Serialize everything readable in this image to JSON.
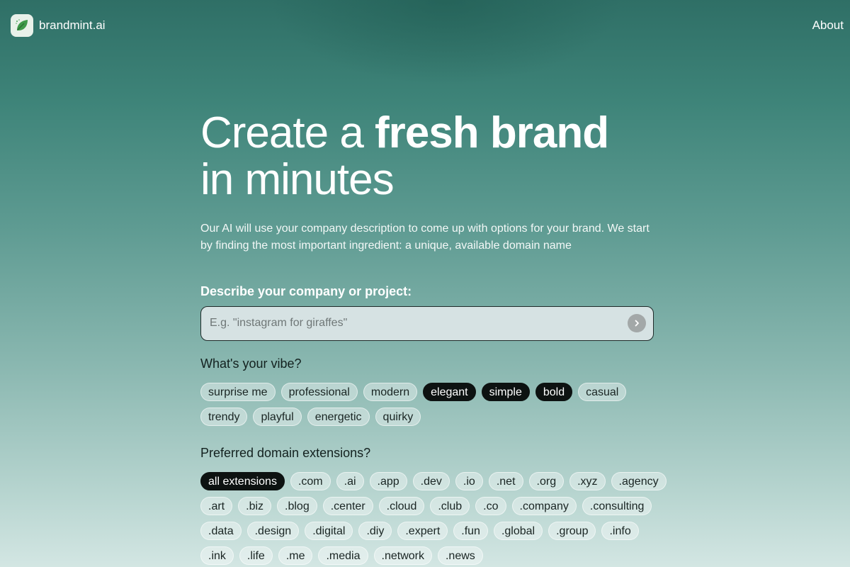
{
  "header": {
    "brand_name": "brandmint.ai",
    "logo_icon": "leaf-icon",
    "about_label": "About"
  },
  "hero": {
    "title_part1": "Create a ",
    "title_bold": "fresh brand",
    "title_part2": "in minutes",
    "intro": "Our AI will use your company description to come up with options for your brand. We start by finding the most important ingredient: a unique, available domain name"
  },
  "describe": {
    "label": "Describe your company or project:",
    "value": "",
    "placeholder": "E.g. \"instagram for giraffes\"",
    "submit_icon": "chevron-right-icon"
  },
  "vibe": {
    "label": "What's your vibe?",
    "options": [
      {
        "label": "surprise me",
        "selected": false
      },
      {
        "label": "professional",
        "selected": false
      },
      {
        "label": "modern",
        "selected": false
      },
      {
        "label": "elegant",
        "selected": true
      },
      {
        "label": "simple",
        "selected": true
      },
      {
        "label": "bold",
        "selected": true
      },
      {
        "label": "casual",
        "selected": false
      },
      {
        "label": "trendy",
        "selected": false
      },
      {
        "label": "playful",
        "selected": false
      },
      {
        "label": "energetic",
        "selected": false
      },
      {
        "label": "quirky",
        "selected": false
      }
    ]
  },
  "extensions": {
    "label": "Preferred domain extensions?",
    "options": [
      {
        "label": "all extensions",
        "selected": true
      },
      {
        "label": ".com",
        "selected": false
      },
      {
        "label": ".ai",
        "selected": false
      },
      {
        "label": ".app",
        "selected": false
      },
      {
        "label": ".dev",
        "selected": false
      },
      {
        "label": ".io",
        "selected": false
      },
      {
        "label": ".net",
        "selected": false
      },
      {
        "label": ".org",
        "selected": false
      },
      {
        "label": ".xyz",
        "selected": false
      },
      {
        "label": ".agency",
        "selected": false
      },
      {
        "label": ".art",
        "selected": false
      },
      {
        "label": ".biz",
        "selected": false
      },
      {
        "label": ".blog",
        "selected": false
      },
      {
        "label": ".center",
        "selected": false
      },
      {
        "label": ".cloud",
        "selected": false
      },
      {
        "label": ".club",
        "selected": false
      },
      {
        "label": ".co",
        "selected": false
      },
      {
        "label": ".company",
        "selected": false
      },
      {
        "label": ".consulting",
        "selected": false
      },
      {
        "label": ".data",
        "selected": false
      },
      {
        "label": ".design",
        "selected": false
      },
      {
        "label": ".digital",
        "selected": false
      },
      {
        "label": ".diy",
        "selected": false
      },
      {
        "label": ".expert",
        "selected": false
      },
      {
        "label": ".fun",
        "selected": false
      },
      {
        "label": ".global",
        "selected": false
      },
      {
        "label": ".group",
        "selected": false
      },
      {
        "label": ".info",
        "selected": false
      },
      {
        "label": ".ink",
        "selected": false
      },
      {
        "label": ".life",
        "selected": false
      },
      {
        "label": ".me",
        "selected": false
      },
      {
        "label": ".media",
        "selected": false
      },
      {
        "label": ".network",
        "selected": false
      },
      {
        "label": ".news",
        "selected": false
      }
    ]
  },
  "colors": {
    "selected_chip": "#0d1211",
    "accent_teal": "#3e8479"
  }
}
